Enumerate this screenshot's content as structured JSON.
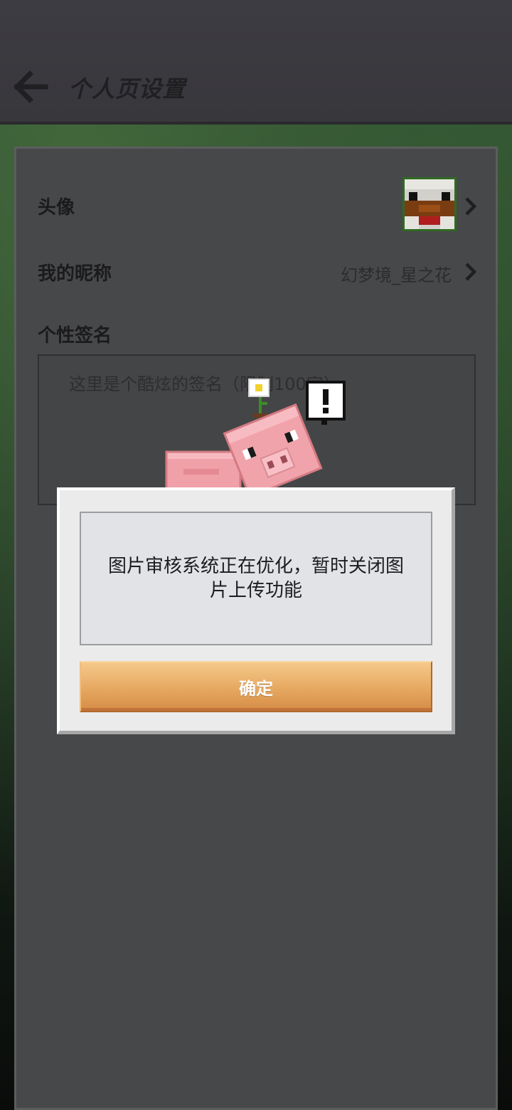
{
  "header": {
    "title": "个人页设置"
  },
  "profile": {
    "avatar_label": "头像",
    "nickname_label": "我的昵称",
    "nickname_value": "幻梦境_星之花",
    "signature_label": "个性签名",
    "signature_placeholder": "这里是个酷炫的签名（限制100字）"
  },
  "dialog": {
    "message": "图片审核系统正在优化，暂时关闭图片上传功能",
    "confirm_label": "确定"
  },
  "colors": {
    "header_bg": "#3d3c42",
    "panel_bg": "#474849",
    "dialog_bg": "#ebebeb",
    "confirm_button": "#e6a861"
  }
}
